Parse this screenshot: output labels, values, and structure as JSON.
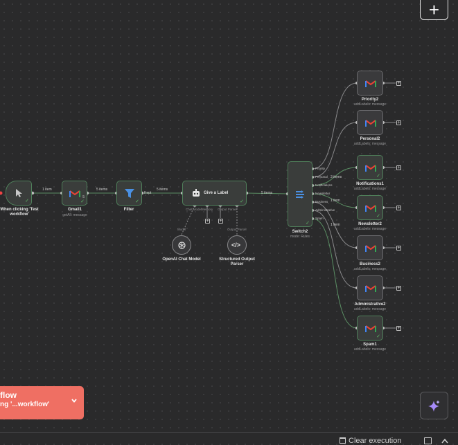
{
  "canvas": {
    "trigger": {
      "label": "When clicking 'Test workflow'"
    },
    "gmail": {
      "label": "Gmail1",
      "sub": "getAll: message",
      "count": "5"
    },
    "filter": {
      "label": "Filter"
    },
    "give_label": {
      "label": "Give a Label",
      "ports": [
        "Chat Model*",
        "Memory",
        "Output Parser"
      ]
    },
    "openai": {
      "label": "OpenAI Chat Model",
      "port": "Model"
    },
    "parser": {
      "label": "Structured Output Parser",
      "port": "Output Parser"
    },
    "switch": {
      "label": "Switch2",
      "sub": "mode: Rules",
      "outputs": [
        "Priority",
        "Personal",
        "Notifications",
        "Newsletter",
        "Business",
        "Administrative",
        "Spam"
      ]
    },
    "edges": {
      "trigger_gmail": "1 item",
      "gmail_filter": "5 items",
      "filter_kept": "Kept",
      "filter_give": "5 items",
      "give_switch": "5 items",
      "notifications": "3 items",
      "newsletter": "1 item",
      "spam": "1 item"
    },
    "targets": [
      {
        "label": "Priority2",
        "sub": "addLabels: message"
      },
      {
        "label": "Personal2",
        "sub": "addLabels: message"
      },
      {
        "label": "Notifications1",
        "sub": "addLabels: message"
      },
      {
        "label": "Newsletter2",
        "sub": "addLabels: message"
      },
      {
        "label": "Business2",
        "sub": "addLabels: message"
      },
      {
        "label": "Administrative2",
        "sub": "addLabels: message"
      },
      {
        "label": "Spam1",
        "sub": "addLabels: message"
      }
    ]
  },
  "toast": {
    "line1": "flow",
    "line2": "ng '...workflow'"
  },
  "bottom": {
    "clear_execution": "Clear execution"
  },
  "colors": {
    "success": "#5fbf6a",
    "toast": "#ef6f63",
    "canvas": "#2a2a2b",
    "gmail_red": "#ea4335"
  }
}
